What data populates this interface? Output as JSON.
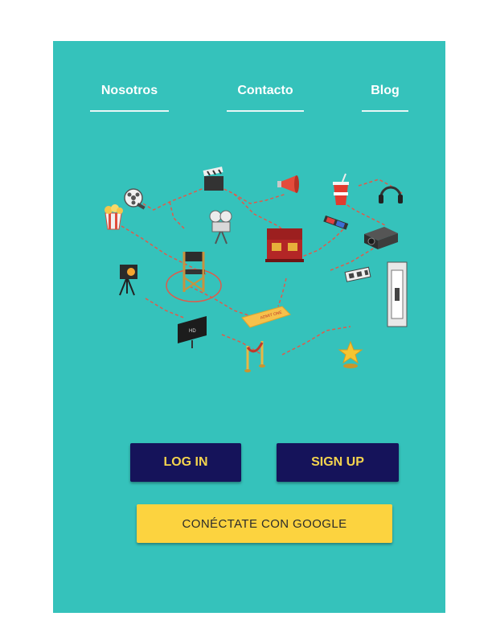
{
  "nav": {
    "items": [
      {
        "label": "Nosotros"
      },
      {
        "label": "Contacto"
      },
      {
        "label": "Blog"
      }
    ]
  },
  "auth": {
    "login_label": "LOG IN",
    "signup_label": "SIGN UP",
    "google_label": "CONÉCTATE CON GOOGLE"
  },
  "illustration": {
    "ticket_text": "ADMIT ONE",
    "tv_text": "HD",
    "icons": [
      "film-reel-icon",
      "clapperboard-icon",
      "megaphone-icon",
      "soda-cup-icon",
      "headphones-icon",
      "popcorn-icon",
      "film-projector-icon",
      "3d-glasses-icon",
      "cinema-seats-icon",
      "video-projector-icon",
      "stage-light-icon",
      "directors-chair-icon",
      "film-strip-icon",
      "film-frame-icon",
      "hd-tv-icon",
      "ticket-icon",
      "stanchion-icon",
      "star-award-icon"
    ]
  },
  "colors": {
    "background": "#35c2bb",
    "nav_text": "#ffffff",
    "dark_button": "#15135a",
    "dark_button_text": "#f4d44e",
    "google_button": "#fcd33f",
    "connector": "#e05a4a"
  }
}
